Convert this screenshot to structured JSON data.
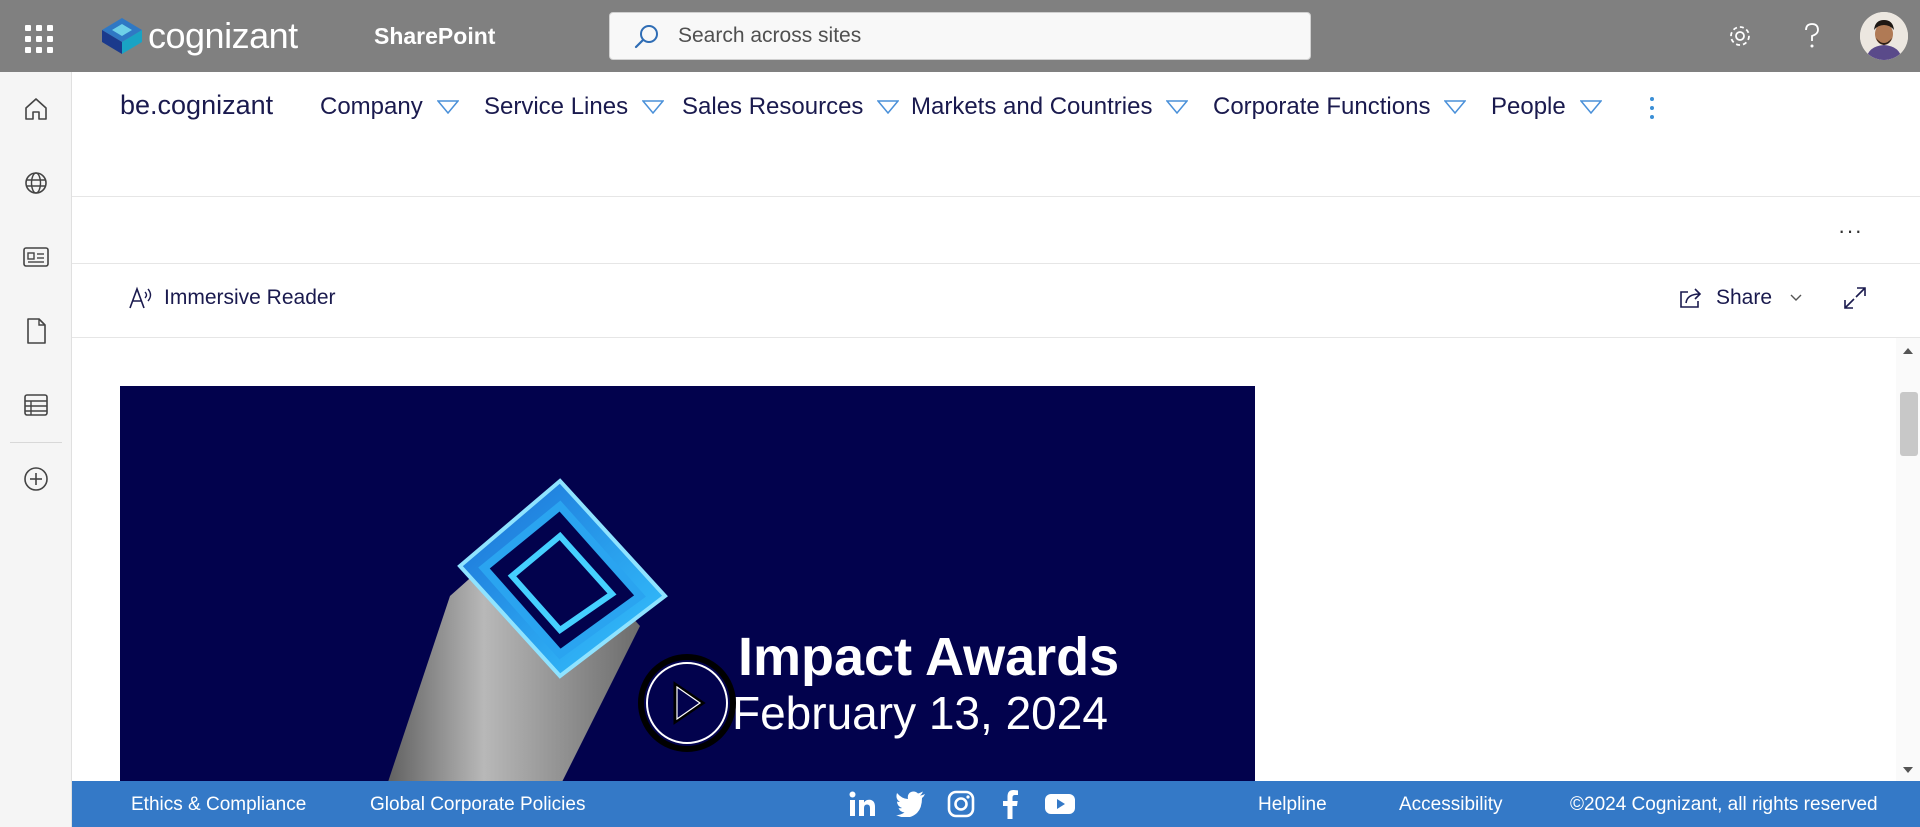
{
  "topbar": {
    "logo_text": "cognizant",
    "app_name": "SharePoint",
    "search_placeholder": "Search across sites",
    "settings_icon": "gear-icon",
    "help_icon": "question-icon"
  },
  "left_rail": {
    "items": [
      "home-icon",
      "globe-icon",
      "news-icon",
      "file-icon",
      "list-icon",
      "add-circle-icon"
    ]
  },
  "site_nav": {
    "site_title": "be.cognizant",
    "items": [
      {
        "label": "Company"
      },
      {
        "label": "Service Lines"
      },
      {
        "label": "Sales Resources"
      },
      {
        "label": "Markets and Countries"
      },
      {
        "label": "Corporate Functions"
      },
      {
        "label": "People"
      }
    ]
  },
  "command_bar": {
    "more_label": "···"
  },
  "read_bar": {
    "immersive_reader_label": "Immersive Reader",
    "share_label": "Share"
  },
  "video": {
    "title": "Impact Awards",
    "date": "February 13, 2024"
  },
  "footer": {
    "links": [
      "Ethics & Compliance",
      "Global Corporate Policies",
      "Helpline",
      "Accessibility"
    ],
    "copyright": "©2024 Cognizant, all rights reserved",
    "social": [
      "linkedin-icon",
      "twitter-icon",
      "instagram-icon",
      "facebook-icon",
      "youtube-icon"
    ]
  },
  "colors": {
    "topbar": "#808080",
    "footer": "#3479c7",
    "nav_text": "#1a1a4e",
    "video_bg": "#02024d",
    "accent": "#3b8fd6"
  }
}
